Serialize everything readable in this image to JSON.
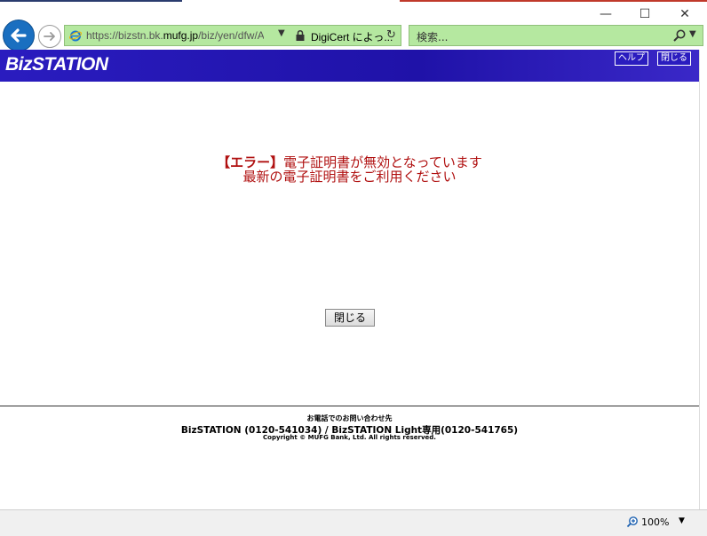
{
  "browser": {
    "url_prefix": "https://bizstn.bk.",
    "url_domain": "mufg.jp",
    "url_suffix": "/biz/yen/dfw/A",
    "cert_label": "DigiCert によっ...",
    "search_placeholder": "検索...",
    "zoom": "100%",
    "window_controls": {
      "minimize": "—",
      "maximize": "☐",
      "close": "✕"
    }
  },
  "header": {
    "logo": "BizSTATION",
    "help_label": "ヘルプ",
    "close_label": "閉じる"
  },
  "main": {
    "error_bracket": "【エラー】",
    "error_line1": "電子証明書が無効となっています",
    "error_line2": "最新の電子証明書をご利用ください",
    "close_button": "閉じる"
  },
  "footer": {
    "contact_heading": "お電話でのお問い合わせ先",
    "phones": "BizSTATION (0120-541034)  /  BizSTATION Light専用(0120-541765)",
    "copyright": "Copyright © MUFG Bank, Ltd. All rights reserved."
  },
  "colors": {
    "brand_band": "#2a1cbf",
    "error_text": "#b01010",
    "address_bar": "#b5e8a0"
  }
}
